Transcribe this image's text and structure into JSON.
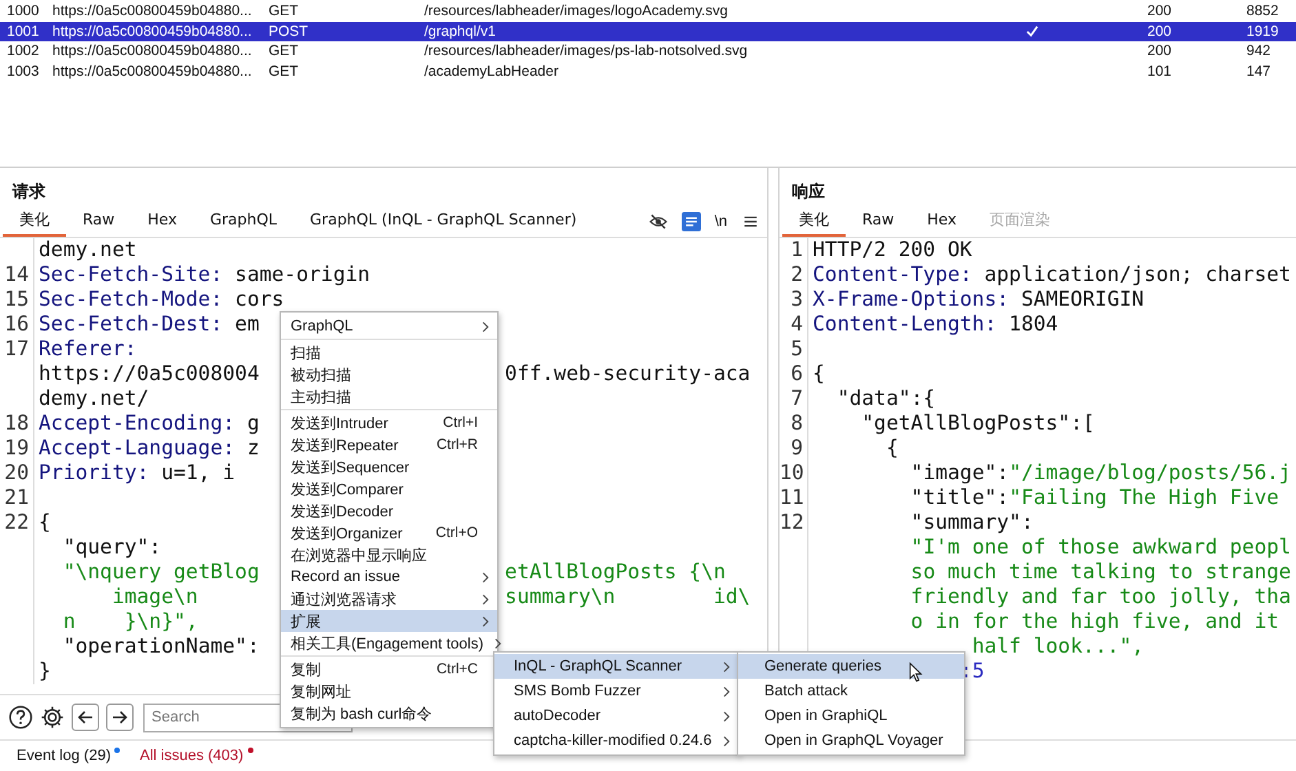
{
  "table": {
    "rows": [
      {
        "id": "1000",
        "url": "https://0a5c00800459b04880...",
        "method": "GET",
        "path": "/resources/labheader/images/logoAcademy.svg",
        "checked": false,
        "status": "200",
        "length": "8852",
        "selected": false
      },
      {
        "id": "1001",
        "url": "https://0a5c00800459b04880...",
        "method": "POST",
        "path": "/graphql/v1",
        "checked": true,
        "status": "200",
        "length": "1919",
        "selected": true
      },
      {
        "id": "1002",
        "url": "https://0a5c00800459b04880...",
        "method": "GET",
        "path": "/resources/labheader/images/ps-lab-notsolved.svg",
        "checked": false,
        "status": "200",
        "length": "942",
        "selected": false
      },
      {
        "id": "1003",
        "url": "https://0a5c00800459b04880...",
        "method": "GET",
        "path": "/academyLabHeader",
        "checked": false,
        "status": "101",
        "length": "147",
        "selected": false
      }
    ]
  },
  "request": {
    "title": "请求",
    "tabs": [
      {
        "label": "美化",
        "selected": true,
        "disabled": false
      },
      {
        "label": "Raw",
        "selected": false,
        "disabled": false
      },
      {
        "label": "Hex",
        "selected": false,
        "disabled": false
      },
      {
        "label": "GraphQL",
        "selected": false,
        "disabled": false
      },
      {
        "label": "GraphQL (InQL - GraphQL Scanner)",
        "selected": false,
        "disabled": false
      }
    ],
    "newline_toggle": "\\n",
    "wrap_lines_on": true,
    "lines": [
      {
        "pieces": [
          [
            {
              "text": "demy.net",
              "kind": "plain"
            }
          ]
        ]
      },
      {
        "number": "14",
        "pieces": [
          [
            {
              "text": "Sec-Fetch-Site:",
              "kind": "name"
            },
            {
              "text": " same-origin",
              "kind": "plain"
            }
          ]
        ]
      },
      {
        "number": "15",
        "pieces": [
          [
            {
              "text": "Sec-Fetch-Mode:",
              "kind": "name"
            },
            {
              "text": " cors",
              "kind": "plain"
            }
          ]
        ]
      },
      {
        "number": "16",
        "pieces": [
          [
            {
              "text": "Sec-Fetch-Dest:",
              "kind": "name"
            },
            {
              "text": " em",
              "kind": "plain"
            }
          ]
        ]
      },
      {
        "number": "17",
        "pieces": [
          [
            {
              "text": "Referer:",
              "kind": "name"
            }
          ]
        ]
      },
      {
        "pieces": [
          [
            {
              "text": "https://0a5c008004",
              "kind": "plain"
            }
          ],
          [
            {
              "text": "                    0ff.web-security-aca",
              "kind": "plain"
            }
          ]
        ]
      },
      {
        "pieces": [
          [
            {
              "text": "demy.net/",
              "kind": "plain"
            }
          ]
        ]
      },
      {
        "number": "18",
        "pieces": [
          [
            {
              "text": "Accept-Encoding:",
              "kind": "name"
            },
            {
              "text": " g",
              "kind": "plain"
            }
          ]
        ]
      },
      {
        "number": "19",
        "pieces": [
          [
            {
              "text": "Accept-Language:",
              "kind": "name"
            },
            {
              "text": " z",
              "kind": "plain"
            }
          ]
        ]
      },
      {
        "number": "20",
        "pieces": [
          [
            {
              "text": "Priority:",
              "kind": "name"
            },
            {
              "text": " u=1, i",
              "kind": "plain"
            }
          ]
        ]
      },
      {
        "number": "21"
      },
      {
        "number": "22",
        "pieces": [
          [
            {
              "text": "{",
              "kind": "plain"
            }
          ]
        ]
      },
      {
        "pieces": [
          [
            {
              "text": "  \"query\":",
              "kind": "plain"
            }
          ]
        ]
      },
      {
        "pieces": [
          [
            {
              "text": "  \"\\nquery getBlog",
              "kind": "string"
            }
          ],
          [
            {
              "text": "                    etAllBlogPosts {\\n",
              "kind": "string"
            }
          ]
        ]
      },
      {
        "pieces": [
          [
            {
              "text": "      image\\n",
              "kind": "string"
            }
          ],
          [
            {
              "text": "                         summary\\n        id\\",
              "kind": "string"
            }
          ]
        ]
      },
      {
        "pieces": [
          [
            {
              "text": "  n    }\\n}\",",
              "kind": "string"
            }
          ]
        ]
      },
      {
        "pieces": [
          [
            {
              "text": "  \"operationName\":",
              "kind": "plain"
            }
          ]
        ]
      },
      {
        "pieces": [
          [
            {
              "text": "}",
              "kind": "plain"
            }
          ]
        ]
      }
    ],
    "search": {
      "placeholder": "Search"
    }
  },
  "response": {
    "title": "响应",
    "tabs": [
      {
        "label": "美化",
        "selected": true,
        "disabled": false
      },
      {
        "label": "Raw",
        "selected": false,
        "disabled": false
      },
      {
        "label": "Hex",
        "selected": false,
        "disabled": false
      },
      {
        "label": "页面渲染",
        "selected": false,
        "disabled": true
      }
    ],
    "lines": [
      {
        "number": "1",
        "pieces": [
          [
            {
              "text": "HTTP/2 200 OK",
              "kind": "plain"
            }
          ]
        ]
      },
      {
        "number": "2",
        "pieces": [
          [
            {
              "text": "Content-Type:",
              "kind": "name"
            },
            {
              "text": " application/json; charset",
              "kind": "plain"
            }
          ]
        ]
      },
      {
        "number": "3",
        "pieces": [
          [
            {
              "text": "X-Frame-Options:",
              "kind": "name"
            },
            {
              "text": " SAMEORIGIN",
              "kind": "plain"
            }
          ]
        ]
      },
      {
        "number": "4",
        "pieces": [
          [
            {
              "text": "Content-Length:",
              "kind": "name"
            },
            {
              "text": " 1804",
              "kind": "plain"
            }
          ]
        ]
      },
      {
        "number": "5"
      },
      {
        "number": "6",
        "pieces": [
          [
            {
              "text": "{",
              "kind": "plain"
            }
          ]
        ]
      },
      {
        "number": "7",
        "pieces": [
          [
            {
              "text": "  \"data\":{",
              "kind": "plain"
            }
          ]
        ]
      },
      {
        "number": "8",
        "pieces": [
          [
            {
              "text": "    \"getAllBlogPosts\":[",
              "kind": "plain"
            }
          ]
        ]
      },
      {
        "number": "9",
        "pieces": [
          [
            {
              "text": "      {",
              "kind": "plain"
            }
          ]
        ]
      },
      {
        "number": "10",
        "pieces": [
          [
            {
              "text": "        \"image\":",
              "kind": "plain"
            },
            {
              "text": "\"/image/blog/posts/56.j",
              "kind": "string"
            }
          ]
        ]
      },
      {
        "number": "11",
        "pieces": [
          [
            {
              "text": "        \"title\":",
              "kind": "plain"
            },
            {
              "text": "\"Failing The High Five",
              "kind": "string"
            }
          ]
        ]
      },
      {
        "number": "12",
        "pieces": [
          [
            {
              "text": "        \"summary\":",
              "kind": "plain"
            }
          ]
        ]
      },
      {
        "pieces": [
          [
            {
              "text": "        \"I'm one of those awkward peopl",
              "kind": "string"
            }
          ]
        ]
      },
      {
        "pieces": [
          [
            {
              "text": "        so much time talking to strange",
              "kind": "string"
            }
          ]
        ]
      },
      {
        "pieces": [
          [
            {
              "text": "        friendly and far too jolly, tha",
              "kind": "string"
            }
          ]
        ]
      },
      {
        "pieces": [
          [
            {
              "text": "        o in for the high five, and it",
              "kind": "string"
            }
          ]
        ]
      },
      {
        "pieces": [
          [
            {
              "text": "             half look...\",",
              "kind": "string"
            }
          ]
        ]
      },
      {
        "pieces": [
          [
            {
              "text": "            :5",
              "kind": "number"
            }
          ]
        ]
      }
    ]
  },
  "status_bar": [
    {
      "label": "Event log (29)",
      "color": "#1a73e8",
      "kind": "normal"
    },
    {
      "label": "All issues (403)",
      "color": "#c0102a",
      "kind": "alert"
    }
  ],
  "context_menu": {
    "items": [
      {
        "kind": "item",
        "label": "GraphQL",
        "submenu": true,
        "selected": false
      },
      {
        "kind": "separator"
      },
      {
        "kind": "item",
        "label": "扫描",
        "submenu": false,
        "selected": false
      },
      {
        "kind": "item",
        "label": "被动扫描",
        "submenu": false,
        "selected": false
      },
      {
        "kind": "item",
        "label": "主动扫描",
        "submenu": false,
        "selected": false
      },
      {
        "kind": "separator"
      },
      {
        "kind": "item",
        "label": "发送到Intruder",
        "shortcut": "Ctrl+I",
        "submenu": false,
        "selected": false
      },
      {
        "kind": "item",
        "label": "发送到Repeater",
        "shortcut": "Ctrl+R",
        "submenu": false,
        "selected": false
      },
      {
        "kind": "item",
        "label": "发送到Sequencer",
        "submenu": false,
        "selected": false
      },
      {
        "kind": "item",
        "label": "发送到Comparer",
        "submenu": false,
        "selected": false
      },
      {
        "kind": "item",
        "label": "发送到Decoder",
        "submenu": false,
        "selected": false
      },
      {
        "kind": "item",
        "label": "发送到Organizer",
        "shortcut": "Ctrl+O",
        "submenu": false,
        "selected": false
      },
      {
        "kind": "item",
        "label": "在浏览器中显示响应",
        "submenu": false,
        "selected": false
      },
      {
        "kind": "item",
        "label": "Record an issue",
        "submenu": true,
        "selected": false
      },
      {
        "kind": "item",
        "label": "通过浏览器请求",
        "submenu": true,
        "selected": false
      },
      {
        "kind": "item",
        "label": "扩展",
        "submenu": true,
        "selected": true
      },
      {
        "kind": "item",
        "label": "相关工具(Engagement tools)",
        "submenu": true,
        "selected": false
      },
      {
        "kind": "separator"
      },
      {
        "kind": "item",
        "label": "复制",
        "shortcut": "Ctrl+C",
        "submenu": false,
        "selected": false
      },
      {
        "kind": "item",
        "label": "复制网址",
        "submenu": false,
        "selected": false
      },
      {
        "kind": "item",
        "label": "复制为 bash curl命令",
        "submenu": false,
        "selected": false
      }
    ]
  },
  "extensions_menu": {
    "items": [
      {
        "label": "InQL - GraphQL Scanner",
        "submenu": true,
        "selected": true
      },
      {
        "label": "SMS Bomb Fuzzer",
        "submenu": true,
        "selected": false
      },
      {
        "label": "autoDecoder",
        "submenu": true,
        "selected": false
      },
      {
        "label": "captcha-killer-modified 0.24.6",
        "submenu": true,
        "selected": false
      }
    ]
  },
  "inql_menu": {
    "items": [
      {
        "label": "Generate queries",
        "selected": true
      },
      {
        "label": "Batch attack",
        "selected": false
      },
      {
        "label": "Open in GraphiQL",
        "selected": false
      },
      {
        "label": "Open in GraphQL Voyager",
        "selected": false
      }
    ]
  }
}
